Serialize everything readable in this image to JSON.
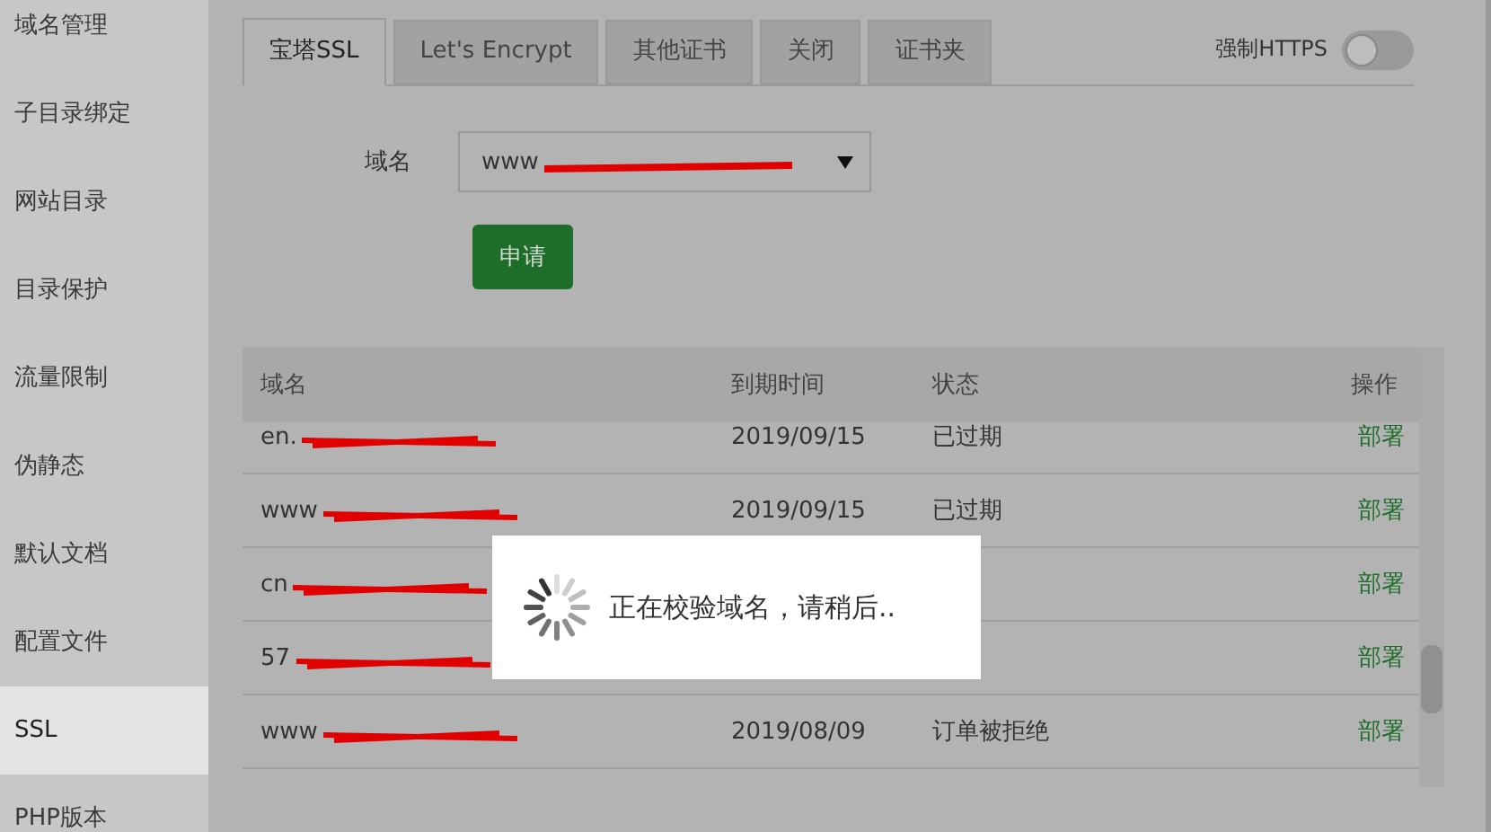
{
  "sidebar": {
    "items": [
      {
        "label": "域名管理",
        "selected": false
      },
      {
        "label": "子目录绑定",
        "selected": false
      },
      {
        "label": "网站目录",
        "selected": false
      },
      {
        "label": "目录保护",
        "selected": false
      },
      {
        "label": "流量限制",
        "selected": false
      },
      {
        "label": "伪静态",
        "selected": false
      },
      {
        "label": "默认文档",
        "selected": false
      },
      {
        "label": "配置文件",
        "selected": false
      },
      {
        "label": "SSL",
        "selected": true
      },
      {
        "label": "PHP版本",
        "selected": false
      }
    ]
  },
  "tabs": [
    {
      "label": "宝塔SSL",
      "selected": true
    },
    {
      "label": "Let's Encrypt",
      "selected": false
    },
    {
      "label": "其他证书",
      "selected": false
    },
    {
      "label": "关闭",
      "selected": false
    },
    {
      "label": "证书夹",
      "selected": false
    }
  ],
  "force_https": {
    "label": "强制HTTPS",
    "on": false
  },
  "domain_select": {
    "label": "域名",
    "value": "www",
    "redacted": true
  },
  "apply_button": "申请",
  "table": {
    "columns": [
      "域名",
      "到期时间",
      "状态",
      "操作"
    ],
    "rows": [
      {
        "domain": "en.",
        "redacted": true,
        "expires": "2019/09/15",
        "status": "已过期",
        "action": "部署"
      },
      {
        "domain": "www",
        "redacted": true,
        "expires": "2019/09/15",
        "status": "已过期",
        "action": "部署"
      },
      {
        "domain": "cn",
        "redacted": true,
        "action": "部署"
      },
      {
        "domain": "57",
        "redacted": true,
        "action": "部署"
      },
      {
        "domain": "www",
        "redacted": true,
        "expires": "2019/08/09",
        "status": "订单被拒绝",
        "action": "部署"
      }
    ]
  },
  "loading_dialog": {
    "message": "正在校验域名，请稍后.."
  }
}
